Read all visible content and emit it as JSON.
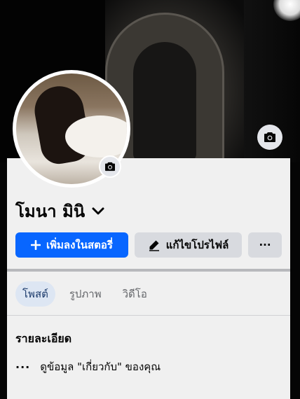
{
  "profile": {
    "name": "โมนา มินิ"
  },
  "actions": {
    "add_story_label": "เพิ่มลงในสตอรี่",
    "edit_profile_label": "แก้ไขโปรไฟล์",
    "more_label": "···"
  },
  "tabs": [
    {
      "label": "โพสต์",
      "active": true
    },
    {
      "label": "รูปภาพ",
      "active": false
    },
    {
      "label": "วิดีโอ",
      "active": false
    }
  ],
  "details": {
    "title": "รายละเอียด",
    "about_link": "ดูข้อมูล \"เกี่ยวกับ\" ของคุณ",
    "about_dots": "···"
  },
  "icons": {
    "cover_camera": "camera-icon",
    "avatar_camera": "camera-icon",
    "plus": "plus-icon",
    "pencil": "pencil-icon",
    "chevron": "chevron-down-icon"
  },
  "colors": {
    "primary": "#0866ff",
    "secondary_button": "#d8dadf",
    "active_tab": "#dde6f3",
    "sheet": "#f0f0f0"
  }
}
